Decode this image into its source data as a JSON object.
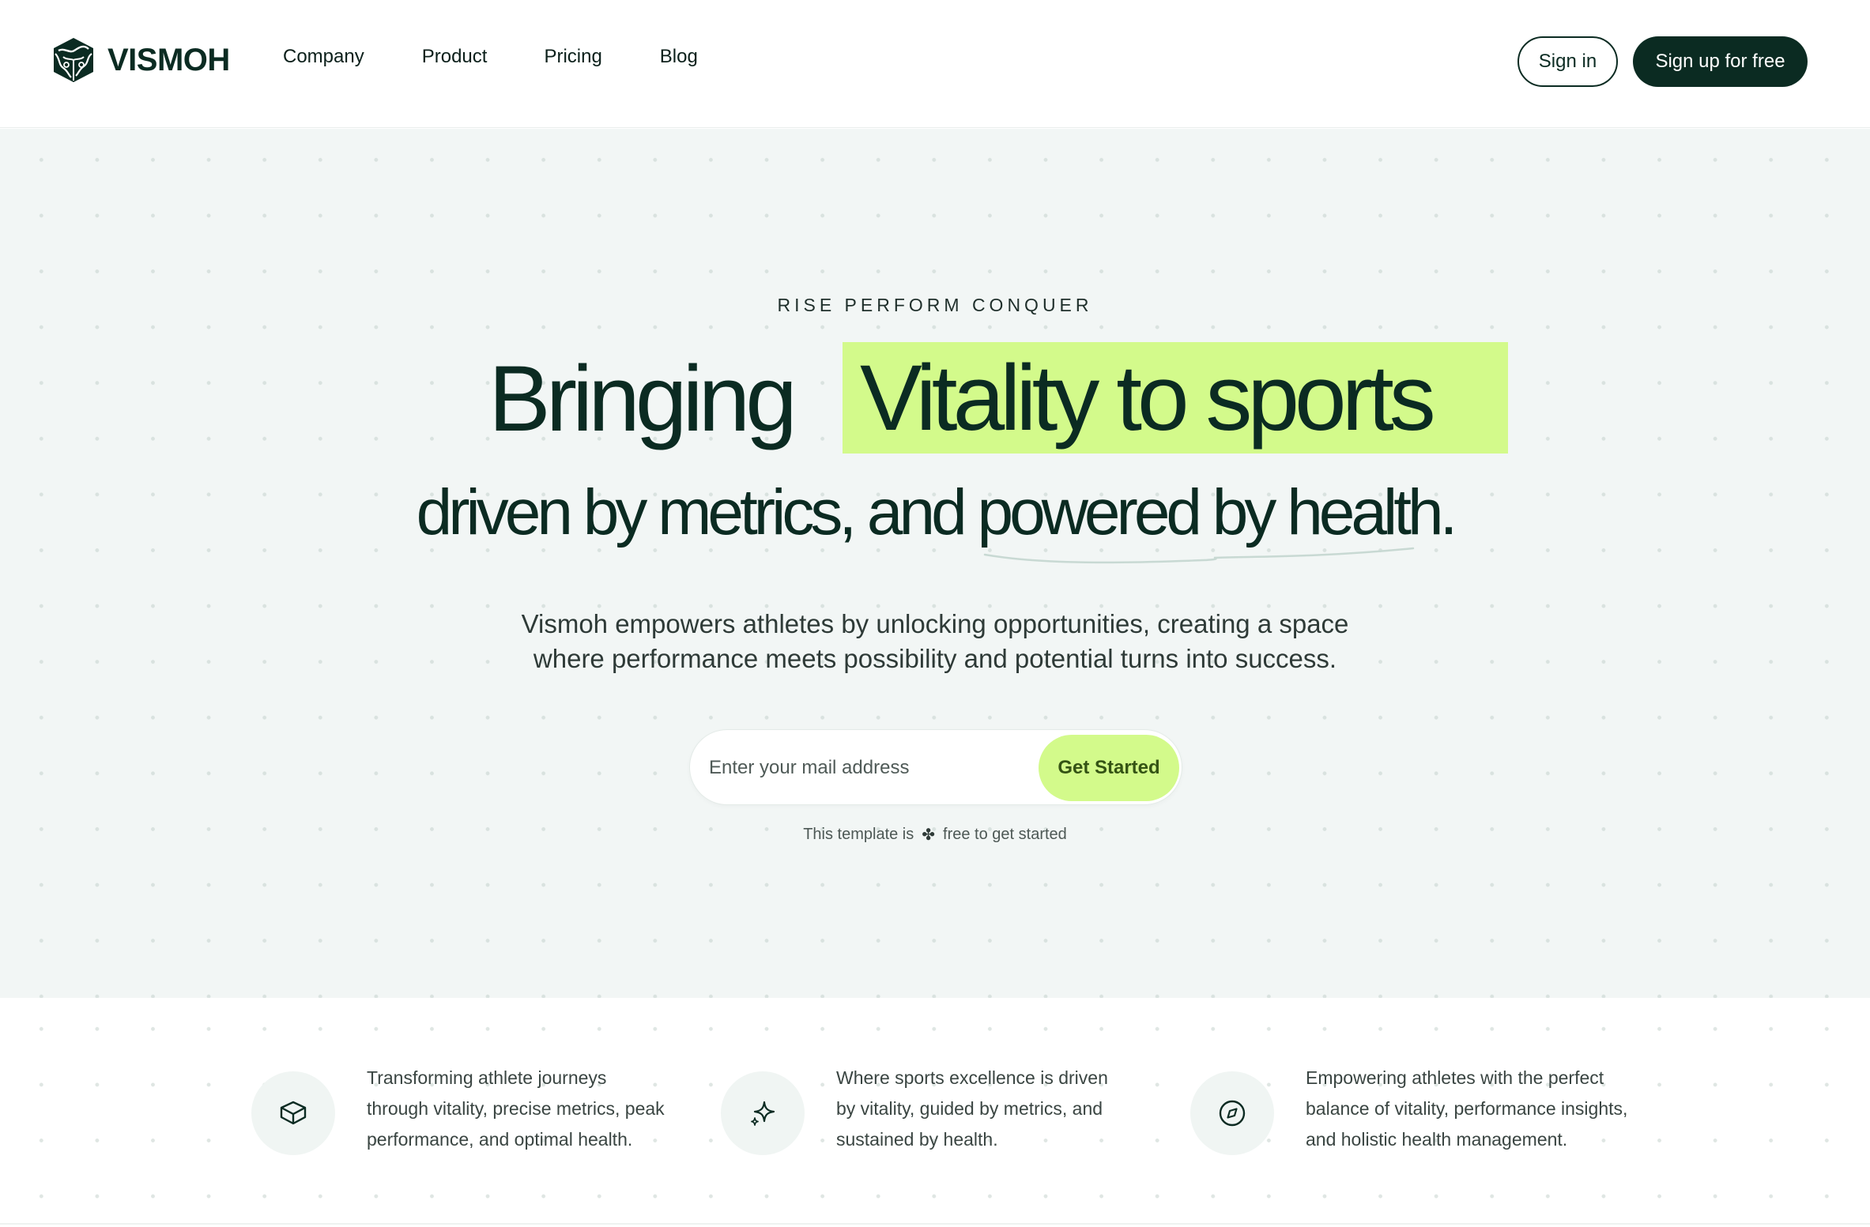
{
  "brand": {
    "name": "VISMOH"
  },
  "nav": {
    "items": [
      {
        "label": "Company"
      },
      {
        "label": "Product"
      },
      {
        "label": "Pricing"
      },
      {
        "label": "Blog"
      }
    ]
  },
  "header_actions": {
    "signin_label": "Sign in",
    "signup_label": "Sign up for free"
  },
  "hero": {
    "eyebrow": "RISE PERFORM CONQUER",
    "headline_part1": "Bringing",
    "headline_highlight": "Vitality to sports",
    "headline_line2": "driven by metrics, and powered by health.",
    "subtitle_lines": [
      "Vismoh empowers athletes by unlocking opportunities, creating a space",
      "where performance meets possibility and potential turns into success."
    ],
    "email_placeholder": "Enter your mail address",
    "cta_label": "Get Started",
    "note_prefix": "This template is",
    "note_suffix": "free to get started"
  },
  "features": [
    {
      "icon": "box-icon",
      "lines": [
        "Transforming athlete journeys",
        "through vitality, precise metrics, peak",
        "performance, and optimal health."
      ]
    },
    {
      "icon": "sparkle-icon",
      "lines": [
        "Where sports excellence is driven",
        "by vitality, guided by metrics, and",
        "sustained by health."
      ]
    },
    {
      "icon": "compass-icon",
      "lines": [
        "Empowering athletes with the perfect",
        "balance of vitality, performance insights,",
        "and holistic health management."
      ]
    }
  ],
  "colors": {
    "brand_dark": "#0b2b22",
    "accent_lime": "#d3fa8b",
    "hero_bg": "#f2f6f5"
  }
}
